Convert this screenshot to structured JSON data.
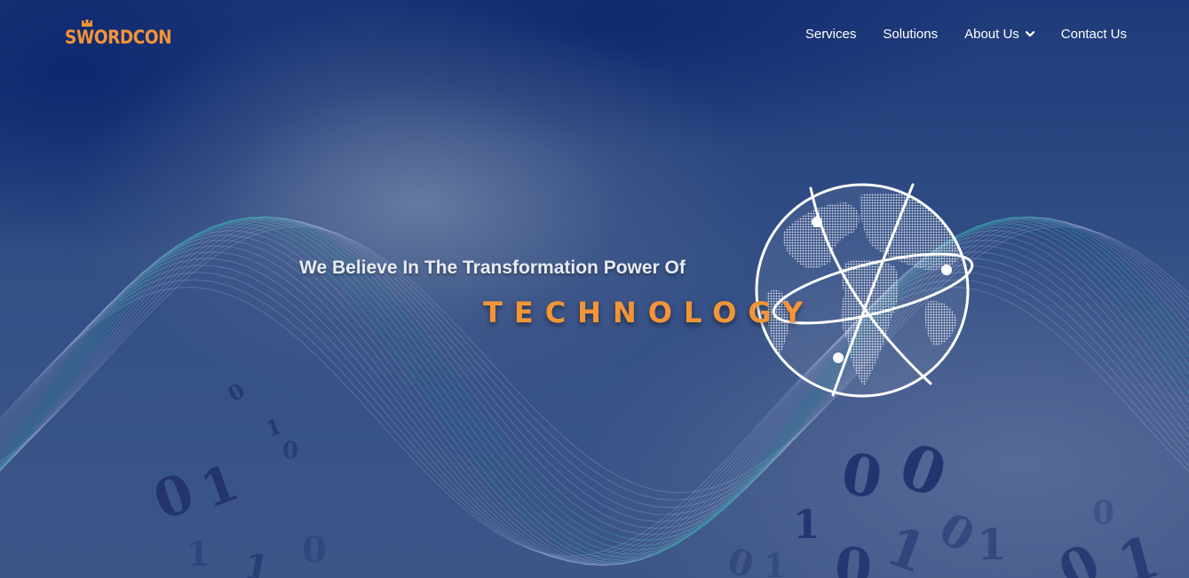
{
  "brand": {
    "name": "SWORDCON",
    "color": "#f39437"
  },
  "nav": {
    "items": [
      {
        "label": "Services"
      },
      {
        "label": "Solutions"
      },
      {
        "label": "About Us",
        "has_dropdown": true
      },
      {
        "label": "Contact Us"
      }
    ]
  },
  "hero": {
    "tagline": "We Believe In The Transformation Power Of",
    "headline": "TECHNOLOGY",
    "accent_color": "#f39437"
  },
  "decor": {
    "binary_digits": [
      "0",
      "1",
      "0",
      "1",
      "0",
      "1",
      "0",
      "0",
      "1",
      "0",
      "1",
      "0",
      "1",
      "0",
      "1",
      "0",
      "1",
      "0",
      "0",
      "1"
    ]
  }
}
